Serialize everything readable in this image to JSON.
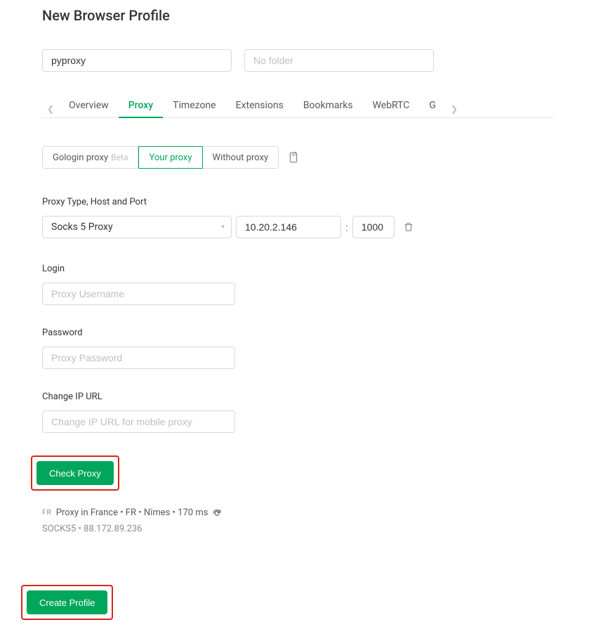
{
  "pageTitle": "New Browser Profile",
  "profileName": {
    "value": "pyproxy"
  },
  "folder": {
    "placeholder": "No folder"
  },
  "tabs": {
    "overview": "Overview",
    "proxy": "Proxy",
    "timezone": "Timezone",
    "extensions": "Extensions",
    "bookmarks": "Bookmarks",
    "webrtc": "WebRTC",
    "g": "G"
  },
  "proxySource": {
    "gologin": "Gologin proxy",
    "gologinBeta": "Beta",
    "your": "Your proxy",
    "without": "Without proxy"
  },
  "proxyTypeLabel": "Proxy Type, Host and Port",
  "proxyType": {
    "selected": "Socks 5 Proxy"
  },
  "host": {
    "value": "10.20.2.146"
  },
  "port": {
    "value": "1000"
  },
  "colon": ":",
  "loginLabel": "Login",
  "loginPlaceholder": "Proxy Username",
  "passwordLabel": "Password",
  "passwordPlaceholder": "Proxy Password",
  "changeIpLabel": "Change IP URL",
  "changeIpPlaceholder": "Change IP URL for mobile proxy",
  "checkProxyLabel": "Check Proxy",
  "result": {
    "badge": "FR",
    "line1": "Proxy in France • FR • Nîmes • 170 ms",
    "line2": "SOCKS5 • 88.172.89.236"
  },
  "createProfileLabel": "Create Profile"
}
